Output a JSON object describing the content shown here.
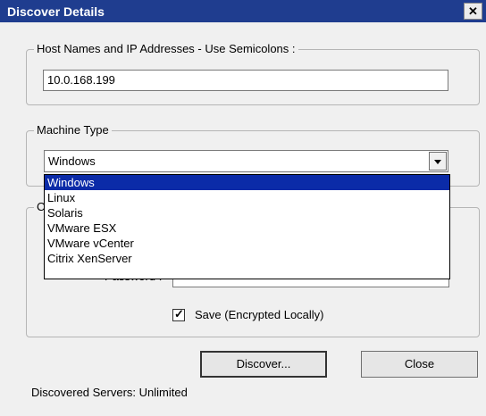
{
  "window": {
    "title": "Discover Details",
    "close_glyph": "✕"
  },
  "hosts": {
    "group_label": "Host Names and IP Addresses - Use Semicolons :",
    "value": "10.0.168.199"
  },
  "machine_type": {
    "group_label": "Machine Type",
    "selected": "Windows",
    "options": [
      "Windows",
      "Linux",
      "Solaris",
      "VMware ESX",
      "VMware vCenter",
      "Citrix XenServer"
    ]
  },
  "credentials": {
    "group_label_visible": "C",
    "password_label": "Password :",
    "password_mask": "••••••••",
    "save_label": "Save (Encrypted Locally)",
    "save_checked": true,
    "check_glyph": "✓"
  },
  "buttons": {
    "discover": "Discover...",
    "close": "Close"
  },
  "status": {
    "text": "Discovered Servers: Unlimited"
  },
  "icons": {
    "dropdown": "chevron-down-icon",
    "close": "close-icon",
    "checkbox": "checkbox-checked-icon"
  }
}
